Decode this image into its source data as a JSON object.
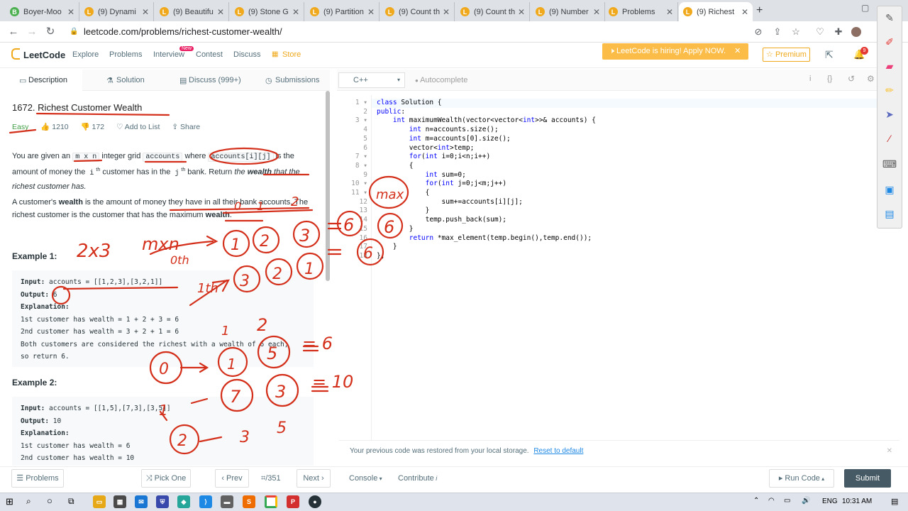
{
  "browser": {
    "tabs": [
      {
        "title": "Boyer-Moo",
        "fav": "B"
      },
      {
        "title": "(9) Dynami",
        "fav": "L"
      },
      {
        "title": "(9) Beautifu",
        "fav": "L"
      },
      {
        "title": "(9) Stone G",
        "fav": "L"
      },
      {
        "title": "(9) Partition",
        "fav": "L"
      },
      {
        "title": "(9) Count th",
        "fav": "L"
      },
      {
        "title": "(9) Count th",
        "fav": "L"
      },
      {
        "title": "(9) Number",
        "fav": "L"
      },
      {
        "title": "Problems",
        "fav": "L"
      },
      {
        "title": "(9) Richest",
        "fav": "L"
      }
    ],
    "url": "leetcode.com/problems/richest-customer-wealth/"
  },
  "header": {
    "logo": "LeetCode",
    "nav": [
      "Explore",
      "Problems",
      "Interview",
      "Contest",
      "Discuss",
      "Store"
    ],
    "new_badge": "New",
    "hiring": "LeetCode is hiring! Apply NOW.",
    "premium": "Premium",
    "notif_count": "9"
  },
  "left_tabs": [
    "Description",
    "Solution",
    "Discuss (999+)",
    "Submissions"
  ],
  "problem": {
    "number": "1672.",
    "title": "Richest Customer Wealth",
    "difficulty": "Easy",
    "likes": "1210",
    "dislikes": "172",
    "add_to_list": "Add to List",
    "share": "Share",
    "p1_a": "You are given an ",
    "p1_code1": "m x n",
    "p1_b": " integer grid ",
    "p1_code2": "accounts",
    "p1_c": " where ",
    "p1_code3": "accounts[i][j]",
    "p1_d": " is the amount of money the ",
    "p1_ith": "i",
    "p1_e": " customer has in the ",
    "p1_jth": "j",
    "p1_f": " bank. Return ",
    "p1_g": "the ",
    "p1_wealth": "wealth",
    "p1_h": " that the richest customer has.",
    "th": "th",
    "p2_a": "A customer's ",
    "p2_wealth": "wealth",
    "p2_b": " is the amount of money they have in all their bank accounts. The richest customer is the customer that has the maximum ",
    "p2_wealth2": "wealth",
    "p2_c": ".",
    "ex1_title": "Example 1:",
    "ex1": [
      {
        "label": "Input:",
        "text": " accounts = [[1,2,3],[3,2,1]]"
      },
      {
        "label": "Output:",
        "text": " 6"
      },
      {
        "label": "Explanation:",
        "text": ""
      },
      {
        "label": "",
        "text": "1st customer has wealth = 1 + 2 + 3 = 6"
      },
      {
        "label": "",
        "text": "2nd customer has wealth = 3 + 2 + 1 = 6"
      },
      {
        "label": "",
        "text": "Both customers are considered the richest with a wealth of 6 each,"
      },
      {
        "label": "",
        "text": "so return 6."
      }
    ],
    "ex2_title": "Example 2:",
    "ex2": [
      {
        "label": "Input:",
        "text": " accounts = [[1,5],[7,3],[3,5]]"
      },
      {
        "label": "Output:",
        "text": " 10"
      },
      {
        "label": "Explanation:",
        "text": ""
      },
      {
        "label": "",
        "text": "1st customer has wealth = 6"
      },
      {
        "label": "",
        "text": "2nd customer has wealth = 10"
      }
    ]
  },
  "editor": {
    "language": "C++",
    "autocomplete": "Autocomplete",
    "lines": [
      "class Solution {",
      "public:",
      "    int maximumWealth(vector<vector<int>>& accounts) {",
      "        int n=accounts.size();",
      "        int m=accounts[0].size();",
      "        vector<int>temp;",
      "        for(int i=0;i<n;i++)",
      "        {",
      "            int sum=0;",
      "            for(int j=0;j<m;j++)",
      "            {",
      "                sum+=accounts[i][j];",
      "            }",
      "            temp.push_back(sum);",
      "        }",
      "        return *max_element(temp.begin(),temp.end());",
      "    }",
      "};"
    ],
    "restore_msg": "Your previous code was restored from your local storage.",
    "reset": "Reset to default"
  },
  "bottom": {
    "problems": "Problems",
    "pick_one": "Pick One",
    "prev": "Prev",
    "page": "/351",
    "next": "Next",
    "console": "Console",
    "contribute": "Contribute",
    "run": "Run Code",
    "submit": "Submit"
  },
  "taskbar": {
    "lang": "ENG",
    "time": "10:31 AM"
  },
  "annotations": {
    "dims": "2x3",
    "mxn": "mxn",
    "zero_th": "0th",
    "first_th": "1th",
    "row0": [
      "1",
      "2",
      "3"
    ],
    "row1": [
      "3",
      "2",
      "1"
    ],
    "col_idx": [
      "0",
      "1",
      "2"
    ],
    "sums": [
      "6",
      "6"
    ],
    "max": "max",
    "max_val": "6",
    "ex2_col_idx": [
      "1",
      "2"
    ],
    "ex2_row_idx": [
      "0",
      "1",
      "2"
    ],
    "ex2_grid": [
      "1",
      "5",
      "7",
      "3",
      "3",
      "5"
    ],
    "ex2_sums": [
      "= 6",
      "= 10"
    ]
  },
  "colors": {
    "accent": "#f0a91c",
    "easy": "#43a047",
    "ink": "#d32f1a",
    "submit": "#455a64"
  }
}
